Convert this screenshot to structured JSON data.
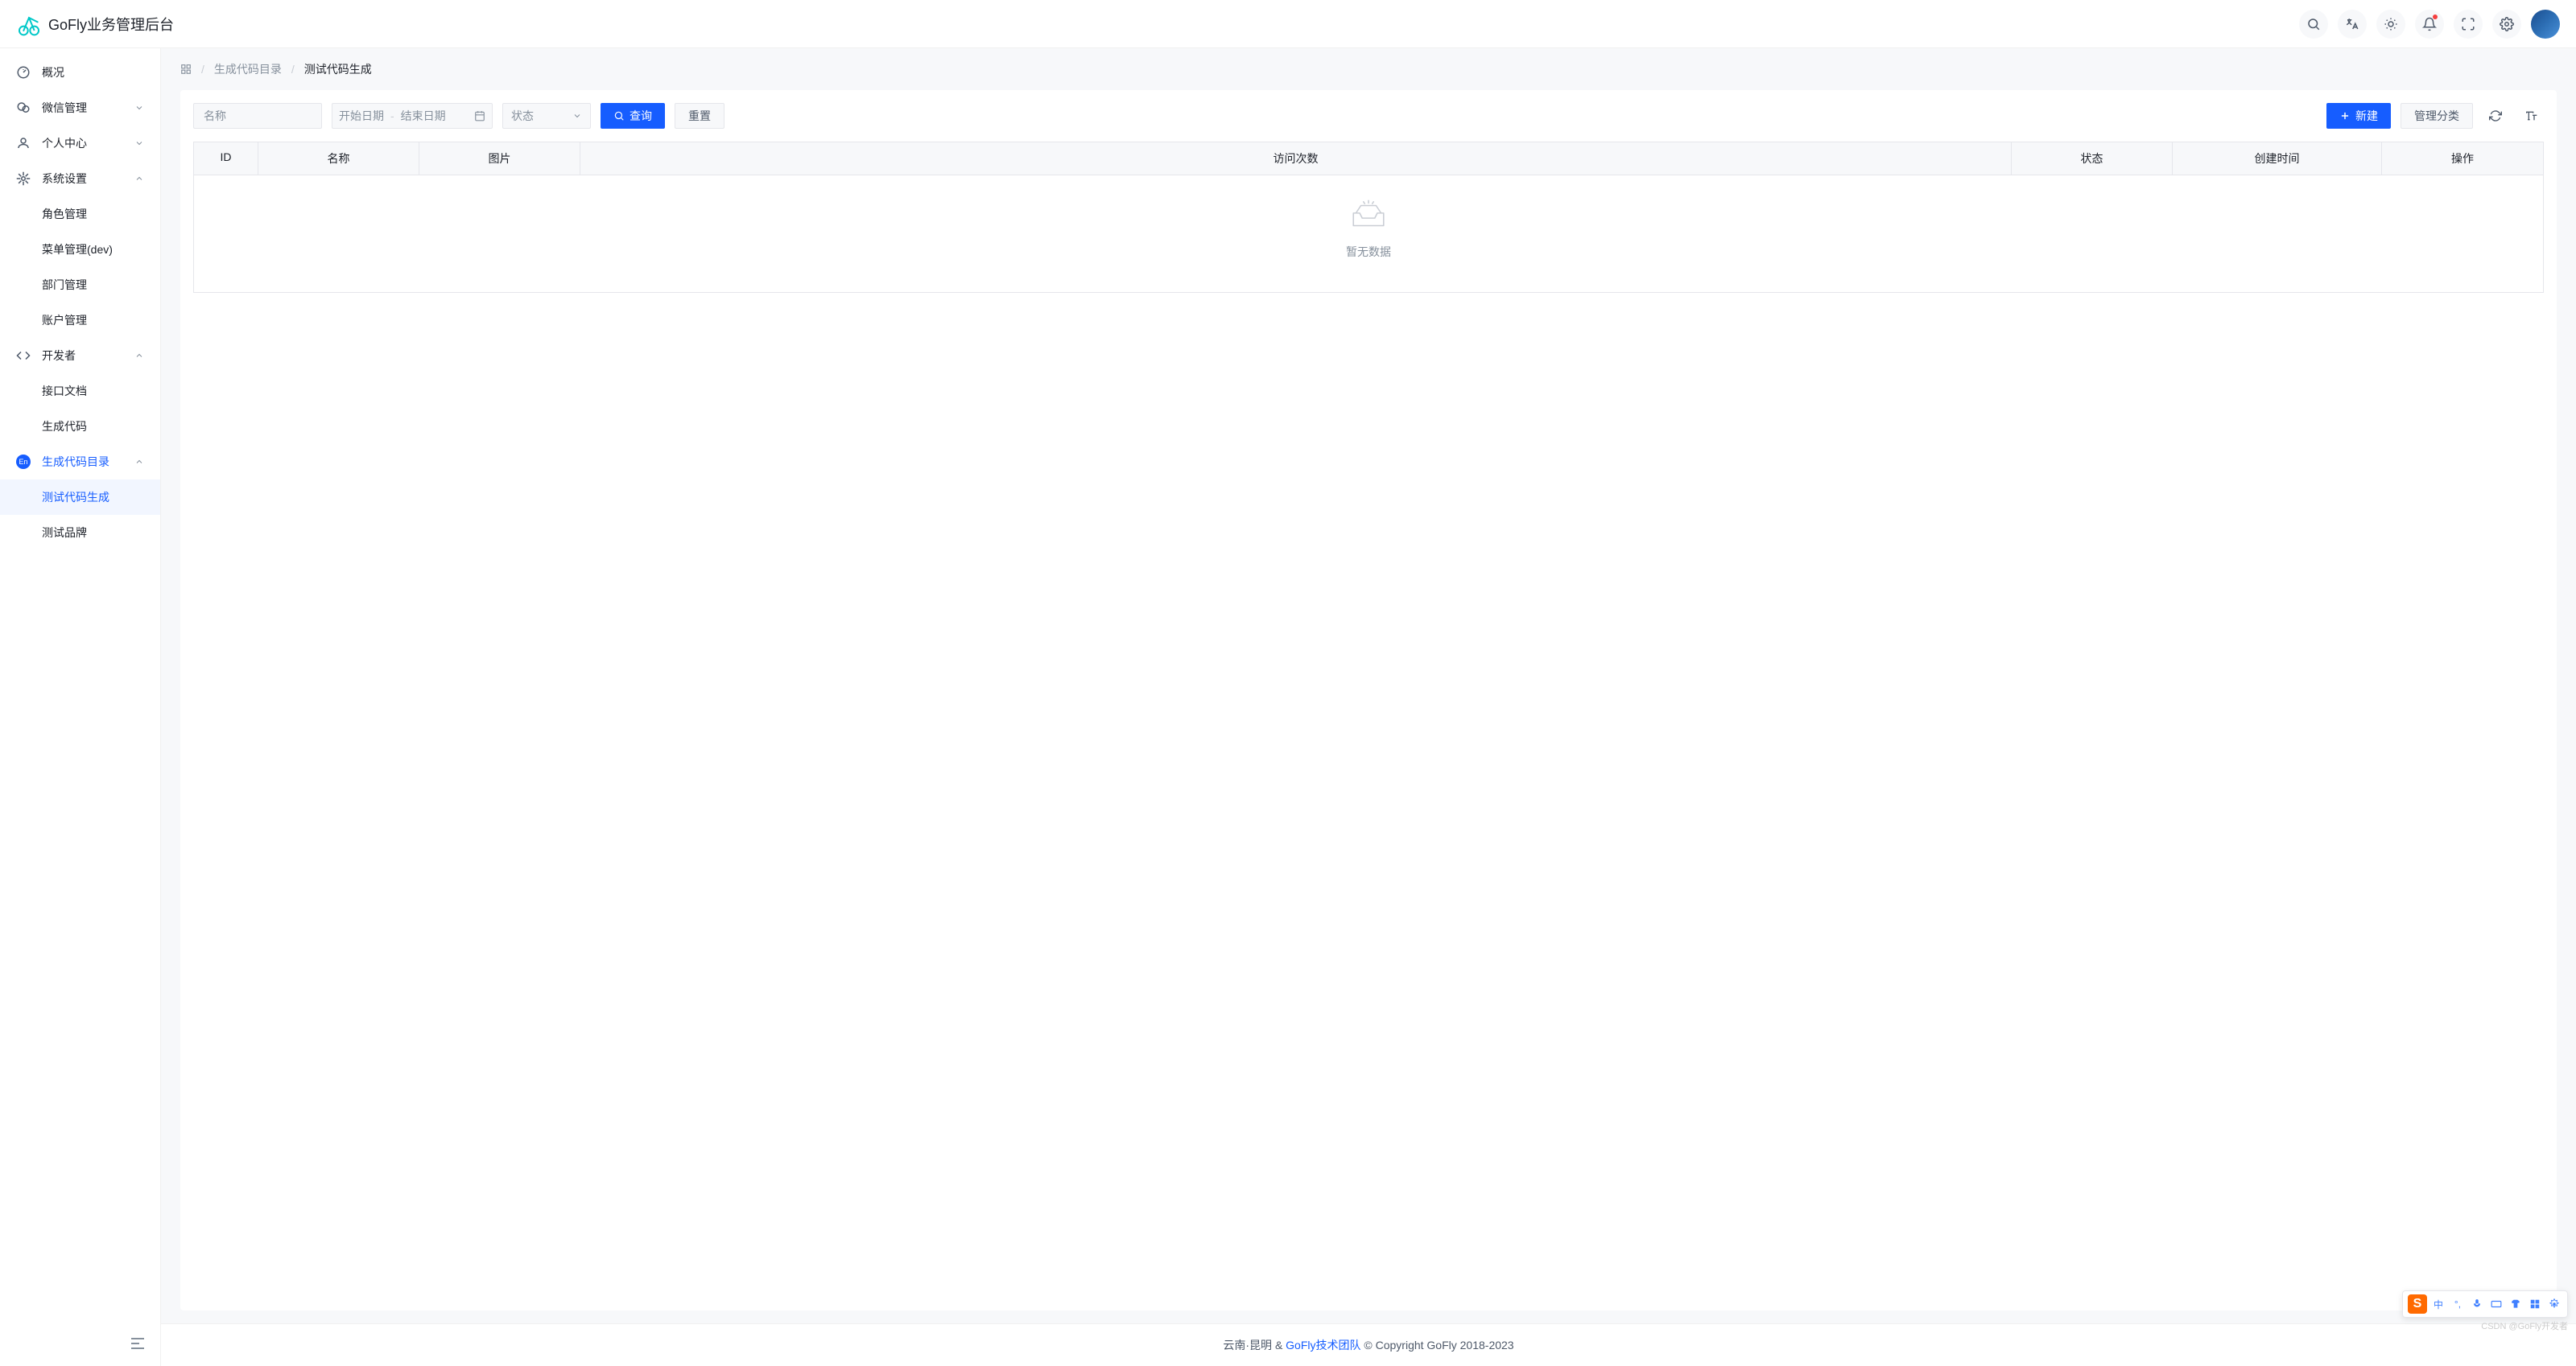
{
  "header": {
    "logo_text": "GoFly业务管理后台"
  },
  "sidebar": {
    "items": [
      {
        "label": "概况",
        "icon": "dashboard"
      },
      {
        "label": "微信管理",
        "icon": "wechat",
        "arrow": "down"
      },
      {
        "label": "个人中心",
        "icon": "user",
        "arrow": "down"
      },
      {
        "label": "系统设置",
        "icon": "settings",
        "arrow": "up"
      },
      {
        "label": "角色管理",
        "sub": true
      },
      {
        "label": "菜单管理(dev)",
        "sub": true
      },
      {
        "label": "部门管理",
        "sub": true
      },
      {
        "label": "账户管理",
        "sub": true
      },
      {
        "label": "开发者",
        "icon": "code",
        "arrow": "up"
      },
      {
        "label": "接口文档",
        "sub": true
      },
      {
        "label": "生成代码",
        "sub": true
      },
      {
        "label": "生成代码目录",
        "icon": "en",
        "arrow": "up",
        "parentActive": true
      },
      {
        "label": "测试代码生成",
        "sub": true,
        "active": true
      },
      {
        "label": "测试品牌",
        "sub": true
      }
    ]
  },
  "breadcrumb": {
    "item1": "生成代码目录",
    "item2": "测试代码生成"
  },
  "toolbar": {
    "name_placeholder": "名称",
    "date_start": "开始日期",
    "date_end": "结束日期",
    "status_placeholder": "状态",
    "search_label": "查询",
    "reset_label": "重置",
    "new_label": "新建",
    "category_label": "管理分类"
  },
  "table": {
    "columns": {
      "id": "ID",
      "name": "名称",
      "image": "图片",
      "visits": "访问次数",
      "status": "状态",
      "created": "创建时间",
      "action": "操作"
    },
    "empty_text": "暂无数据"
  },
  "footer": {
    "left": "云南·昆明 & ",
    "link": "GoFly技术团队",
    "right": " © Copyright GoFly 2018-2023"
  },
  "ime": {
    "lang": "中"
  },
  "watermark": "CSDN @GoFly开发者"
}
